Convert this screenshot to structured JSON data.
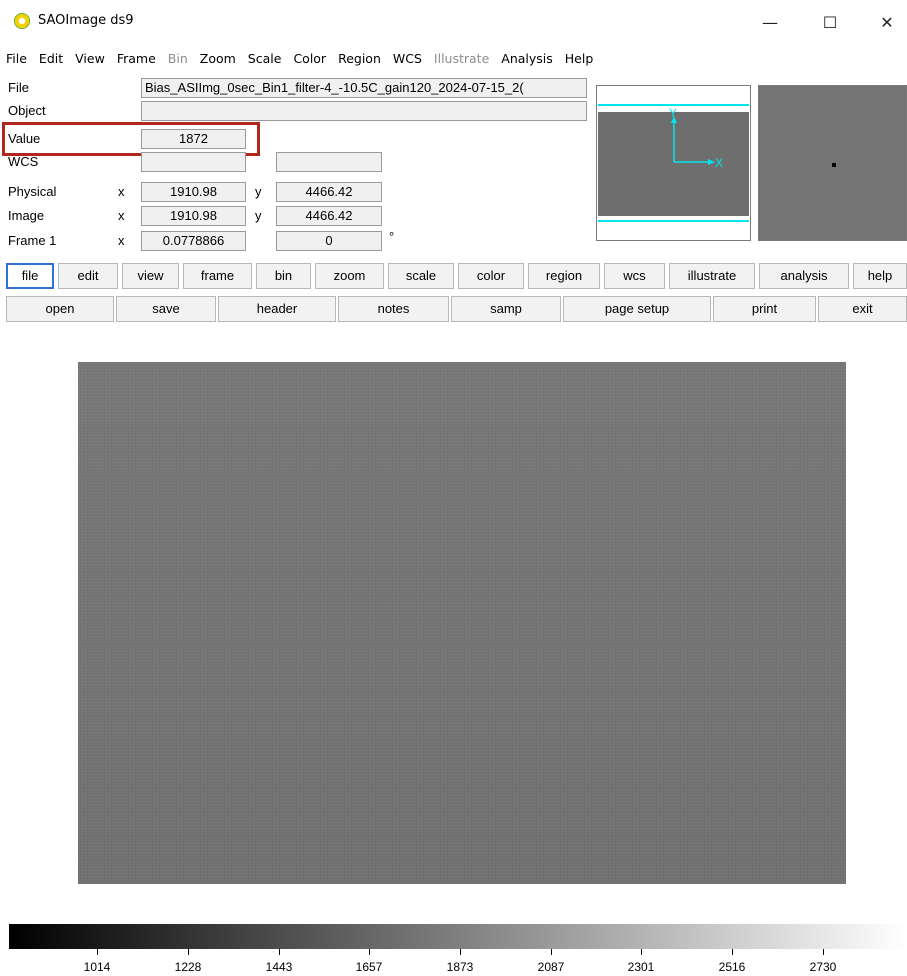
{
  "window": {
    "title": "SAOImage ds9",
    "minimize_glyph": "—",
    "maximize_glyph": "☐",
    "close_glyph": "✕"
  },
  "menu": [
    "File",
    "Edit",
    "View",
    "Frame",
    "Bin",
    "Zoom",
    "Scale",
    "Color",
    "Region",
    "WCS",
    "Illustrate",
    "Analysis",
    "Help"
  ],
  "menu_disabled": [
    "Bin",
    "Illustrate"
  ],
  "info": {
    "labels": {
      "file": "File",
      "object": "Object",
      "value": "Value",
      "wcs": "WCS",
      "physical": "Physical",
      "image": "Image",
      "frame": "Frame 1"
    },
    "file_name": "Bias_ASIImg_0sec_Bin1_filter-4_-10.5C_gain120_2024-07-15_2(",
    "object": "",
    "value": "1872",
    "wcs_value": "",
    "wcs_value2": "",
    "x_label": "x",
    "y_label": "y",
    "physical_x": "1910.98",
    "physical_y": "4466.42",
    "image_x": "1910.98",
    "image_y": "4466.42",
    "frame_zoom": "0.0778866",
    "frame_angle": "0",
    "degree_symbol": "°",
    "compass_y": "Y",
    "compass_x": "X"
  },
  "button_bar": [
    "file",
    "edit",
    "view",
    "frame",
    "bin",
    "zoom",
    "scale",
    "color",
    "region",
    "wcs",
    "illustrate",
    "analysis",
    "help"
  ],
  "button_bar_active": "file",
  "sub_buttons": [
    "open",
    "save",
    "header",
    "notes",
    "samp",
    "page setup",
    "print",
    "exit"
  ],
  "colorbar": {
    "ticks": [
      "1014",
      "1228",
      "1443",
      "1657",
      "1873",
      "2087",
      "2301",
      "2516",
      "2730"
    ]
  },
  "colors": {
    "highlight": "#b3261e",
    "compass": "#00e5ee",
    "active_button": "#2f6fd6",
    "image_gray": "#737373"
  }
}
